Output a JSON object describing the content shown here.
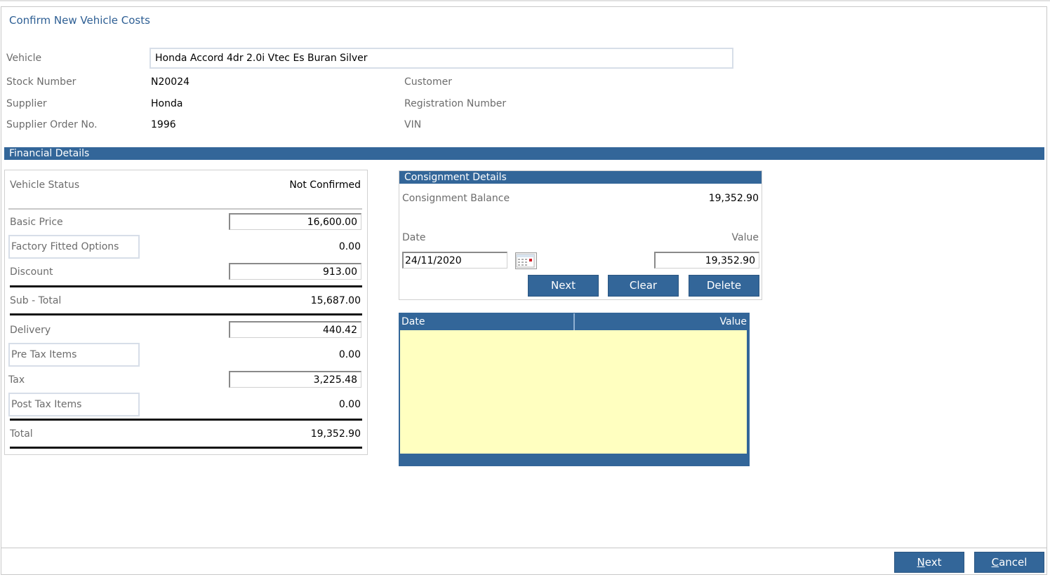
{
  "page": {
    "title": "Confirm New Vehicle Costs"
  },
  "vehicle": {
    "vehicle_label": "Vehicle",
    "vehicle_value": "Honda Accord 4dr 2.0i Vtec Es Buran Silver",
    "stock_label": "Stock Number",
    "stock_value": "N20024",
    "supplier_label": "Supplier",
    "supplier_value": "Honda",
    "order_label": "Supplier Order No.",
    "order_value": "1996",
    "customer_label": "Customer",
    "registration_label": "Registration Number",
    "vin_label": "VIN"
  },
  "financial": {
    "section_title": "Financial Details",
    "status_label": "Vehicle Status",
    "status_value": "Not Confirmed",
    "basic_price_label": "Basic Price",
    "basic_price_value": "16,600.00",
    "factory_options_label": "Factory Fitted Options",
    "factory_options_value": "0.00",
    "discount_label": "Discount",
    "discount_value": "913.00",
    "subtotal_label": "Sub - Total",
    "subtotal_value": "15,687.00",
    "delivery_label": "Delivery",
    "delivery_value": "440.42",
    "pre_tax_label": "Pre Tax Items",
    "pre_tax_value": "0.00",
    "tax_label": "Tax",
    "tax_value": "3,225.48",
    "post_tax_label": "Post Tax Items",
    "post_tax_value": "0.00",
    "total_label": "Total",
    "total_value": "19,352.90"
  },
  "consignment": {
    "title": "Consignment Details",
    "balance_label": "Consignment Balance",
    "balance_value": "19,352.90",
    "date_label": "Date",
    "value_label": "Value",
    "date_value": "24/11/2020",
    "value_value": "19,352.90",
    "next_button": "Next",
    "clear_button": "Clear",
    "delete_button": "Delete",
    "grid_columns": [
      "Date",
      "Value"
    ]
  },
  "footer": {
    "next_button_accel": "N",
    "next_button_rest": "ext",
    "cancel_button_accel": "C",
    "cancel_button_rest": "ancel"
  },
  "colors": {
    "accent": "#336699",
    "title": "#2e5f94",
    "grid_background": "#ffffc0"
  },
  "icons": {
    "date_picker": "calendar-icon"
  }
}
